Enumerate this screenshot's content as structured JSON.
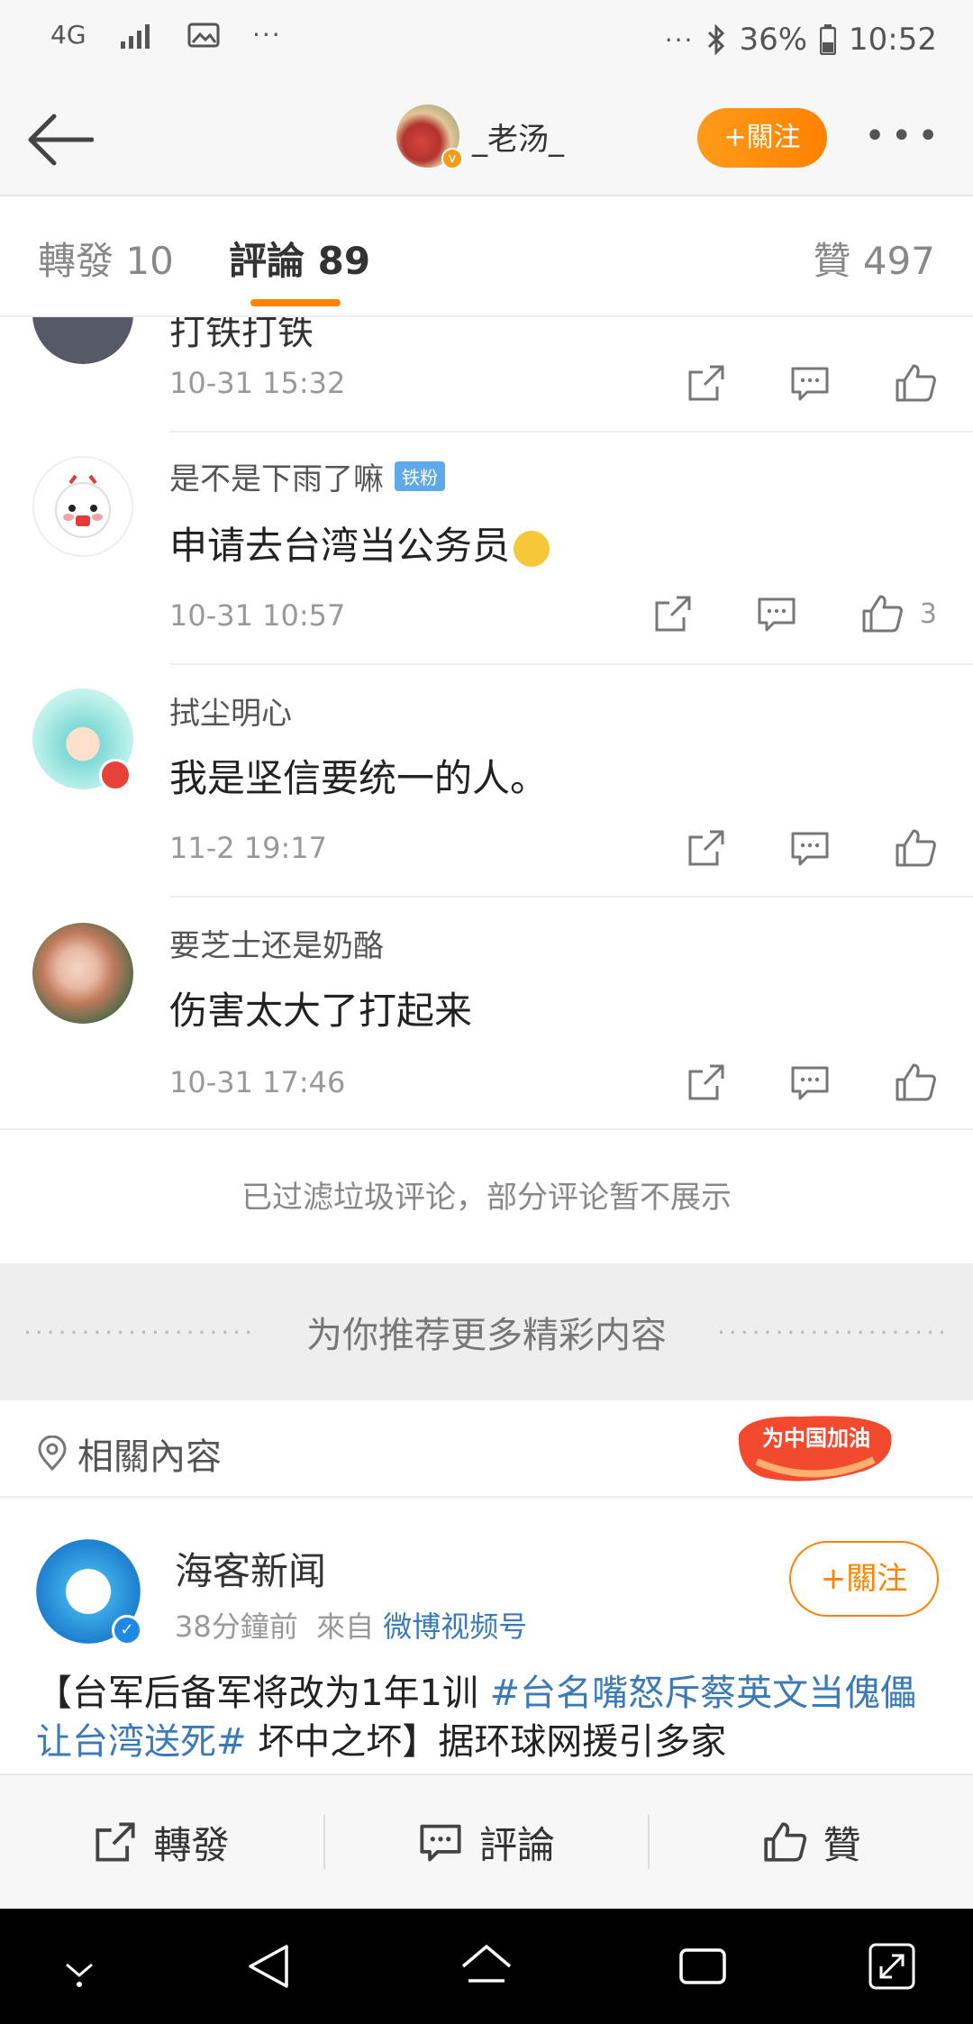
{
  "status_bar": {
    "network": "4G",
    "battery": "36%",
    "time": "10:52",
    "more": "···"
  },
  "header": {
    "author_name": "_老汤_",
    "follow_label": "+關注",
    "more_icon": "more-icon"
  },
  "tabs": [
    {
      "label": "轉發 10"
    },
    {
      "label": "評論 89"
    },
    {
      "label": "贊 497"
    }
  ],
  "comments": {
    "partial": {
      "text": "打铁打铁",
      "time": "10-31 15:32"
    },
    "items": [
      {
        "name": "是不是下雨了嘛",
        "badge": "铁粉",
        "text": "申请去台湾当公务员",
        "time": "10-31 10:57",
        "likes": "3"
      },
      {
        "name": "拭尘明心",
        "text": "我是坚信要统一的人。",
        "time": "11-2 19:17",
        "likes": ""
      },
      {
        "name": "要芝士还是奶酪",
        "text": "伤害太大了打起来",
        "time": "10-31 17:46",
        "likes": ""
      }
    ]
  },
  "filtered_notice": "已过滤垃圾评论，部分评论暂不展示",
  "recommend_banner": "为你推荐更多精彩内容",
  "related": {
    "label": "相關內容",
    "promo_text": "为中国加油"
  },
  "card": {
    "name": "海客新闻",
    "time": "38分鐘前",
    "from_label": "來自",
    "source": "微博视频号",
    "follow_label": "+關注",
    "text_lead": "【台军后备军将改为1年1训 ",
    "text_tag": "#台名嘴怒斥蔡英文当傀儡让台湾送死#",
    "text_tail": " 坏中之坏】据环球网援引多家"
  },
  "bottom_bar": {
    "repost": "轉發",
    "comment": "評論",
    "like": "贊"
  },
  "colors": {
    "accent": "#ff8200",
    "link": "#3a7ab8",
    "fan_badge": "#5fa8ea"
  }
}
